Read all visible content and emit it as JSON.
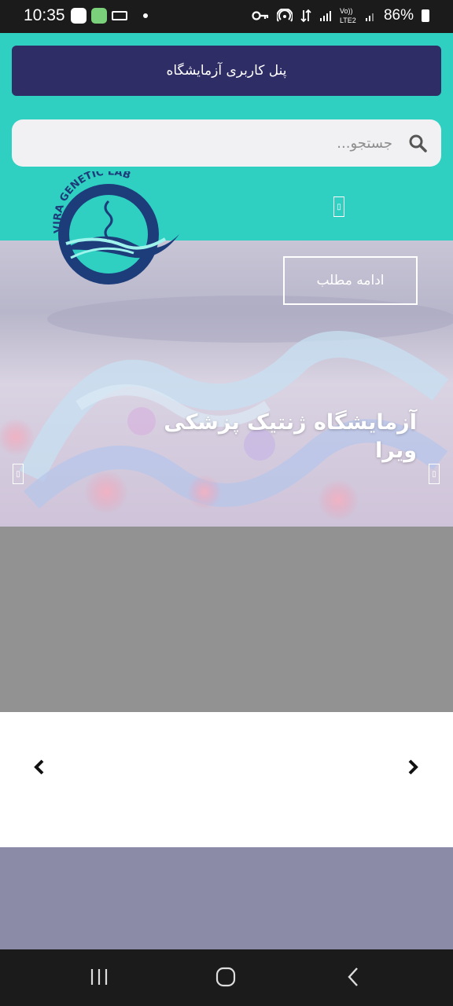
{
  "status_bar": {
    "time": "10:35",
    "network": "Vo)) LTE2",
    "battery": "86%"
  },
  "header": {
    "panel_button_label": "پنل کاربری آزمایشگاه",
    "search_placeholder": "جستجو...",
    "logo_text": "VIRA GENETIC LAB"
  },
  "hero": {
    "title": "آزمایشگاه ژنتیک پزشکی ویرا",
    "read_more_label": "ادامه مطلب"
  },
  "colors": {
    "header_bg": "#2fd0c2",
    "panel_button_bg": "#2e2d66",
    "gray_band": "#929292",
    "footer_band": "#8b8ba7"
  },
  "icons": {
    "search": "search-icon",
    "menu": "menu-icon",
    "carousel_prev": "chevron-left-icon",
    "carousel_next": "chevron-right-icon",
    "nav_recents": "recents-icon",
    "nav_home": "home-icon",
    "nav_back": "back-icon"
  }
}
